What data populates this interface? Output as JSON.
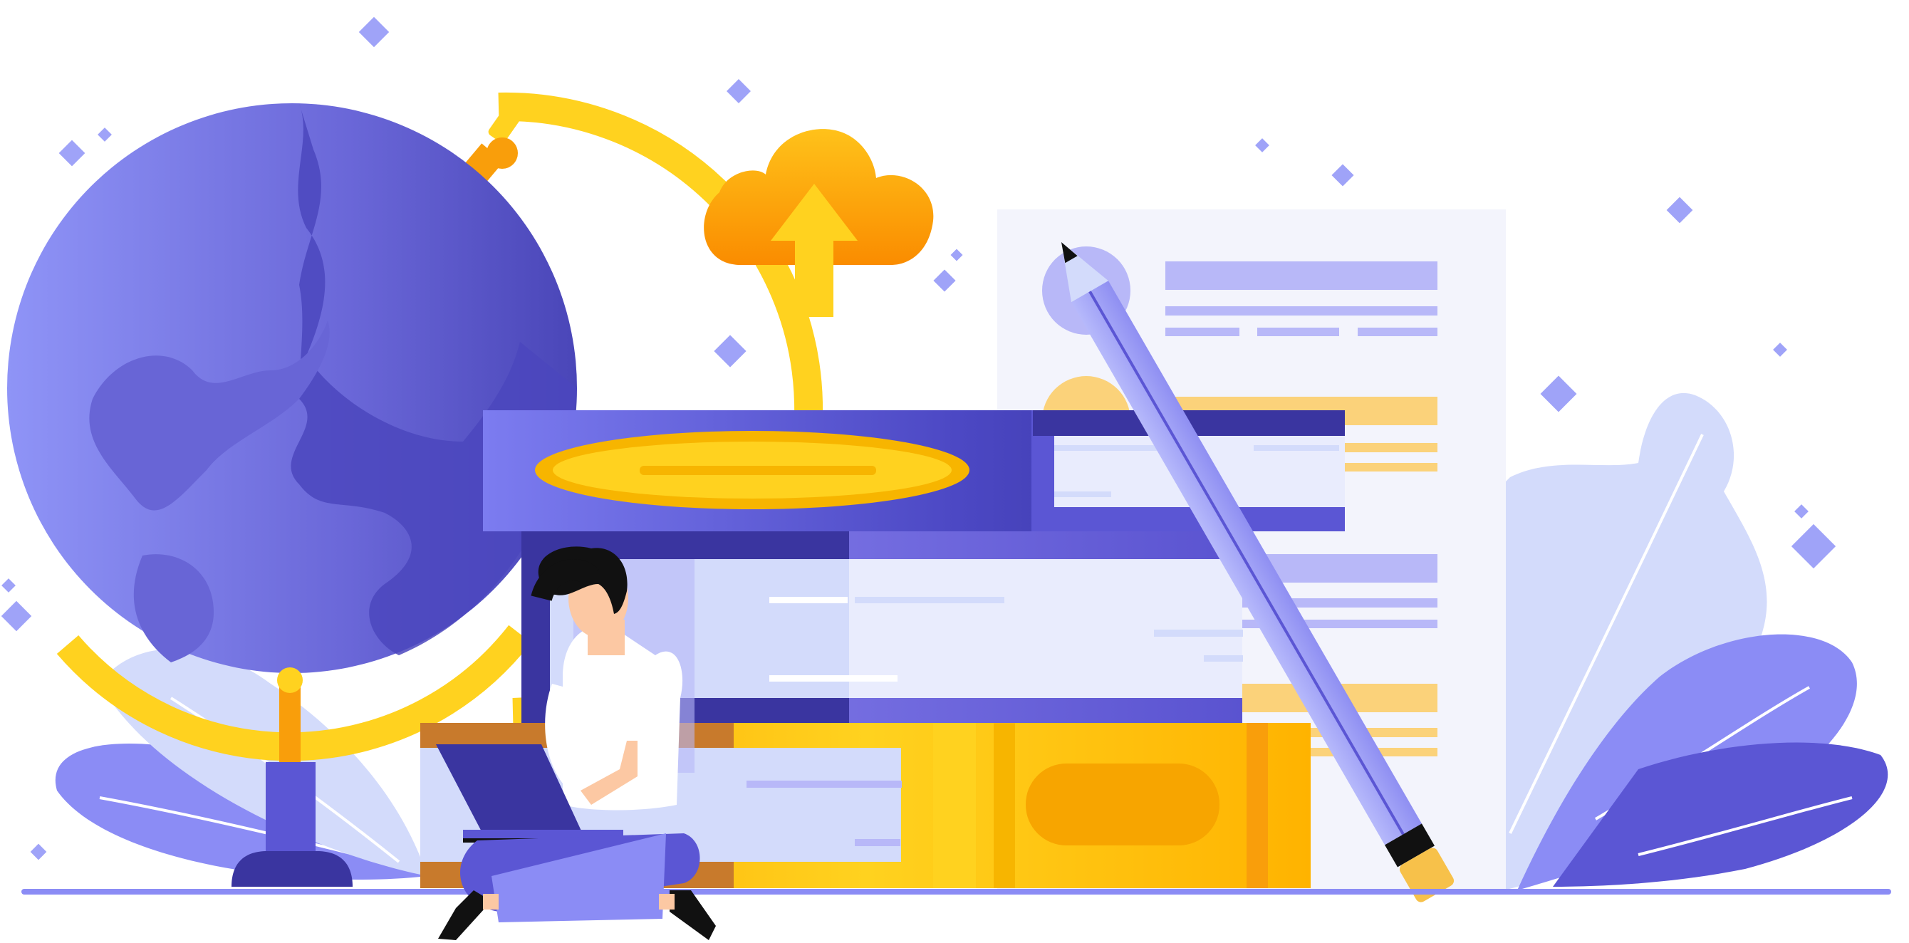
{
  "illustration": {
    "subject": "person-studying-with-laptop",
    "elements": [
      "globe",
      "upload-cloud",
      "book-stack",
      "document-sheet",
      "pencil",
      "leaf-plants",
      "person",
      "laptop",
      "sparkles"
    ]
  },
  "palette": {
    "indigo_dark": "#3a35a0",
    "indigo": "#5b56d4",
    "periwinkle": "#8b8cf5",
    "lavender": "#b8b8f8",
    "pale_blue": "#d3dbfb",
    "page_bg": "#f3f4fc",
    "yellow": "#ffd21f",
    "orange": "#f99e0b",
    "amber": "#f7b500",
    "skin": "#fcc8a3",
    "hair": "#111111"
  }
}
